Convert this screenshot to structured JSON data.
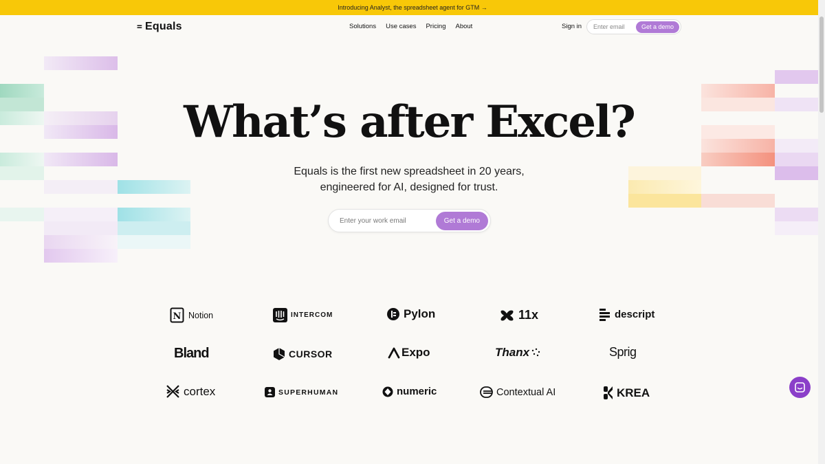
{
  "banner": {
    "text": "Introducing Analyst, the spreadsheet agent for GTM →"
  },
  "nav": {
    "logo_mark": "=",
    "logo_text": "Equals",
    "links": [
      "Solutions",
      "Use cases",
      "Pricing",
      "About"
    ],
    "signin": "Sign in",
    "email_placeholder": "Enter email",
    "demo_label": "Get a demo"
  },
  "hero": {
    "title": "What’s after Excel?",
    "subtitle_line1": "Equals is the first new spreadsheet in 20 years,",
    "subtitle_line2": "engineered for AI, designed for trust.",
    "email_placeholder": "Enter your work email",
    "demo_label": "Get a demo"
  },
  "logos": [
    [
      "Notion",
      "INTERCOM",
      "Pylon",
      "11x",
      "descript"
    ],
    [
      "Bland",
      "CURSOR",
      "Expo",
      "Thanx",
      "Sprig"
    ],
    [
      "cortex",
      "SUPERHUMAN",
      "numeric",
      "Contextual AI",
      "KREA"
    ]
  ],
  "colors": {
    "banner": "#f8c808",
    "accent": "#b07ad6",
    "chat": "#8b3fc9",
    "background": "#faf9f6"
  }
}
